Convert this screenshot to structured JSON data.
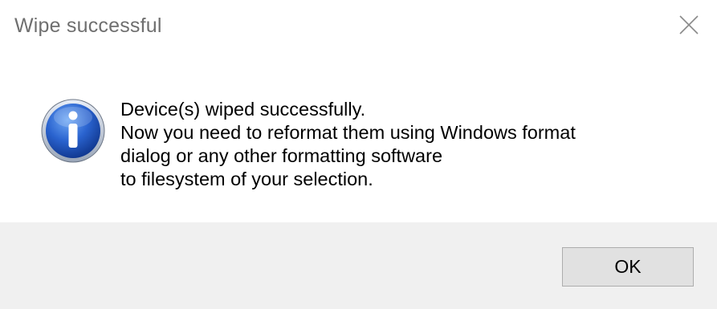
{
  "dialog": {
    "title": "Wipe successful",
    "close_icon": "close-icon",
    "icon": "information-icon",
    "message_lines": [
      "Device(s) wiped successfully.",
      "Now you need to reformat them using Windows format",
      "dialog or any other formatting software",
      "to filesystem of your selection."
    ],
    "ok_label": "OK"
  },
  "colors": {
    "title_text": "#6f6f6f",
    "footer_background": "#f0f0f0",
    "button_background": "#e1e1e1",
    "button_border": "#adadad",
    "icon_blue": "#1e4fb4"
  }
}
